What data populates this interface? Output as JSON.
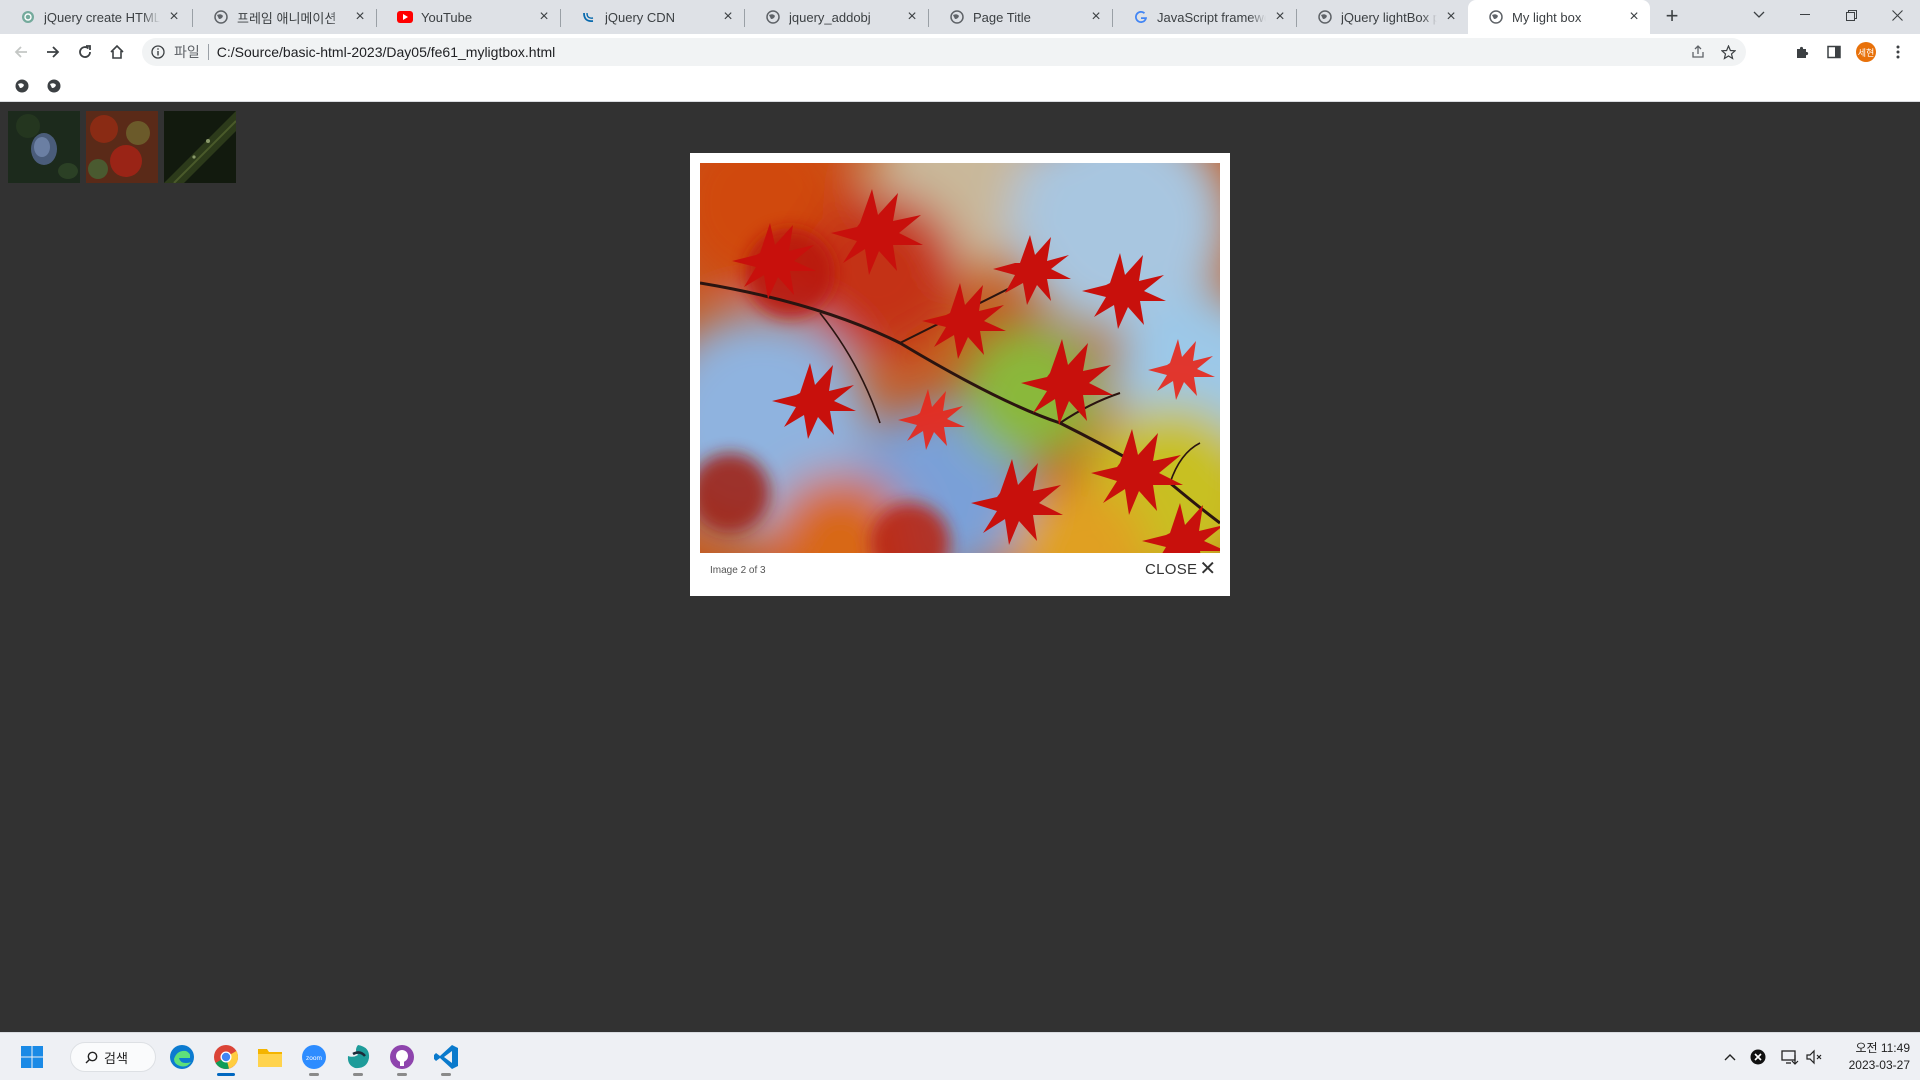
{
  "browser": {
    "tabs": [
      {
        "title": "jQuery create HTML e",
        "icon": "chatgpt-icon",
        "active": false
      },
      {
        "title": "프레임 애니메이션",
        "icon": "globe-icon",
        "active": false
      },
      {
        "title": "YouTube",
        "icon": "youtube-icon",
        "active": false
      },
      {
        "title": "jQuery CDN",
        "icon": "jquery-icon",
        "active": false
      },
      {
        "title": "jquery_addobj",
        "icon": "globe-icon",
        "active": false
      },
      {
        "title": "Page Title",
        "icon": "globe-icon",
        "active": false
      },
      {
        "title": "JavaScript framework",
        "icon": "google-icon",
        "active": false
      },
      {
        "title": "jQuery lightBox plugi",
        "icon": "globe-icon",
        "active": false
      },
      {
        "title": "My light box",
        "icon": "globe-icon",
        "active": true
      }
    ],
    "address": {
      "scheme_label": "파일",
      "url": "C:/Source/basic-html-2023/Day05/fe61_myligtbox.html"
    },
    "profile_label": "세현"
  },
  "page": {
    "lightbox": {
      "caption": "Image 2 of 3",
      "close_label": "CLOSE",
      "close_glyph": "✕"
    },
    "thumbnails": [
      {
        "name": "thumbnail-1",
        "theme": "blue-flower"
      },
      {
        "name": "thumbnail-2",
        "theme": "autumn-leaves"
      },
      {
        "name": "thumbnail-3",
        "theme": "green-leaf"
      }
    ]
  },
  "taskbar": {
    "search_label": "검색",
    "clock": {
      "time": "오전 11:49",
      "date": "2023-03-27"
    }
  },
  "colors": {
    "page_background": "#323232",
    "lightbox_background": "#ffffff",
    "tabstrip": "#dee1e6",
    "accent": "#0067c0"
  }
}
